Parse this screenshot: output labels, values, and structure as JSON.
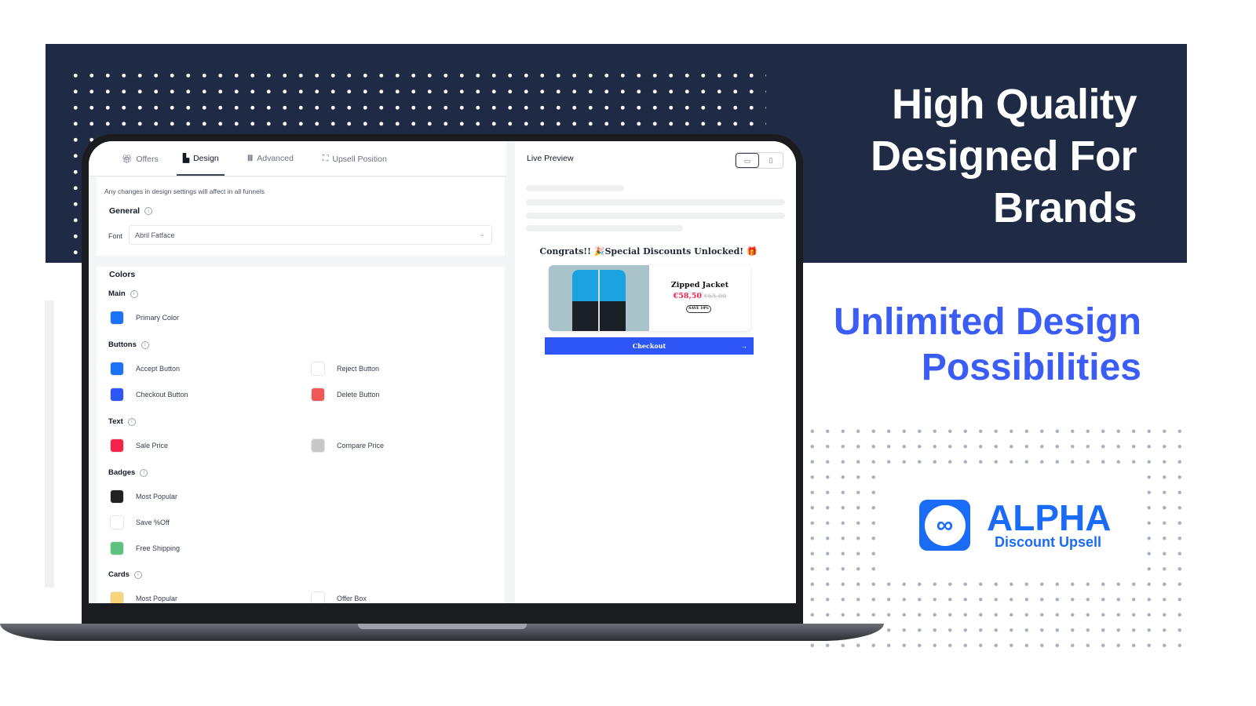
{
  "hero": {
    "headline_lines": [
      "High Quality",
      "Designed For",
      "Brands"
    ],
    "subheadline_lines": [
      "Unlimited Design",
      "Possibilities"
    ]
  },
  "brand": {
    "name": "ALPHA",
    "tagline": "Discount Upsell",
    "color": "#1a6bf5"
  },
  "tabs": [
    {
      "label": "Offers",
      "icon": "gift-icon"
    },
    {
      "label": "Design",
      "icon": "brush-icon",
      "active": true
    },
    {
      "label": "Advanced",
      "icon": "columns-icon"
    },
    {
      "label": "Upsell Position",
      "icon": "position-icon"
    }
  ],
  "notice": "Any changes in design settings will affect in all funnels",
  "general": {
    "title": "General",
    "font_label": "Font",
    "font_value": "Abril Fatface"
  },
  "colors": {
    "title": "Colors",
    "main": {
      "title": "Main",
      "items": [
        {
          "label": "Primary Color",
          "color": "#1a73f5"
        }
      ]
    },
    "buttons": {
      "title": "Buttons",
      "items": [
        {
          "label": "Accept Button",
          "color": "#1a73f5"
        },
        {
          "label": "Reject Button",
          "color": "#ffffff"
        },
        {
          "label": "Checkout Button",
          "color": "#2e55f5"
        },
        {
          "label": "Delete Button",
          "color": "#f25757"
        }
      ]
    },
    "text": {
      "title": "Text",
      "items": [
        {
          "label": "Sale Price",
          "color": "#f5234a"
        },
        {
          "label": "Compare Price",
          "color": "#c8c8c8"
        }
      ]
    },
    "badges": {
      "title": "Badges",
      "items": [
        {
          "label": "Most Popular",
          "color": "#222222"
        },
        {
          "label": "Save %Off",
          "color": "#ffffff"
        },
        {
          "label": "Free Shipping",
          "color": "#5cc27e"
        }
      ]
    },
    "cards": {
      "title": "Cards",
      "items": [
        {
          "label": "Most Popular",
          "color": "#f7d57a"
        },
        {
          "label": "Offer Box",
          "color": "#ffffff"
        }
      ]
    }
  },
  "preview": {
    "title": "Live Preview",
    "headline": "Congrats!! 🎉Special Discounts Unlocked! 🎁",
    "product": "Zipped Jacket",
    "sale_price": "€58,50",
    "compare_price": "€65,00",
    "badge": "SAVE 10%",
    "checkout": "Checkout",
    "arrow": "→"
  }
}
